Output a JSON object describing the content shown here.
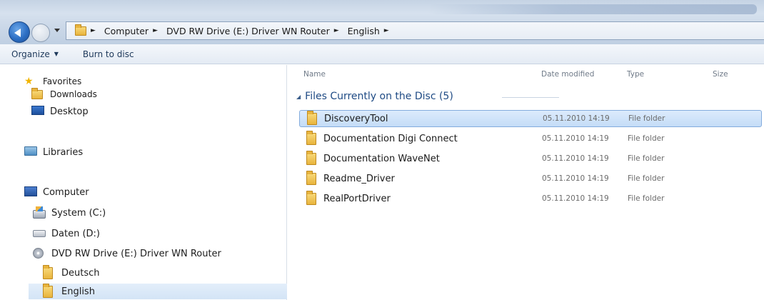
{
  "address_bar": {
    "crumbs": [
      "Computer",
      "DVD RW Drive (E:) Driver WN Router",
      "English"
    ]
  },
  "toolbar": {
    "organize_label": "Organize",
    "burn_label": "Burn to disc"
  },
  "nav": {
    "favorites": "Favorites",
    "downloads": "Downloads",
    "desktop": "Desktop",
    "libraries": "Libraries",
    "computer": "Computer",
    "system": "System (C:)",
    "daten": "Daten (D:)",
    "dvd": "DVD RW Drive (E:) Driver WN Router",
    "deutsch": "Deutsch",
    "english": "English"
  },
  "columns": {
    "name": "Name",
    "date": "Date modified",
    "type": "Type",
    "size": "Size"
  },
  "group": {
    "title": "Files Currently on the Disc (5)"
  },
  "files": [
    {
      "name": "DiscoveryTool",
      "date": "05.11.2010 14:19",
      "type": "File folder"
    },
    {
      "name": "Documentation Digi Connect",
      "date": "05.11.2010 14:19",
      "type": "File folder"
    },
    {
      "name": "Documentation WaveNet",
      "date": "05.11.2010 14:19",
      "type": "File folder"
    },
    {
      "name": "Readme_Driver",
      "date": "05.11.2010 14:19",
      "type": "File folder"
    },
    {
      "name": "RealPortDriver",
      "date": "05.11.2010 14:19",
      "type": "File folder"
    }
  ],
  "colors": {
    "accent": "#1e4a84",
    "selection": "#c4dcf7"
  }
}
